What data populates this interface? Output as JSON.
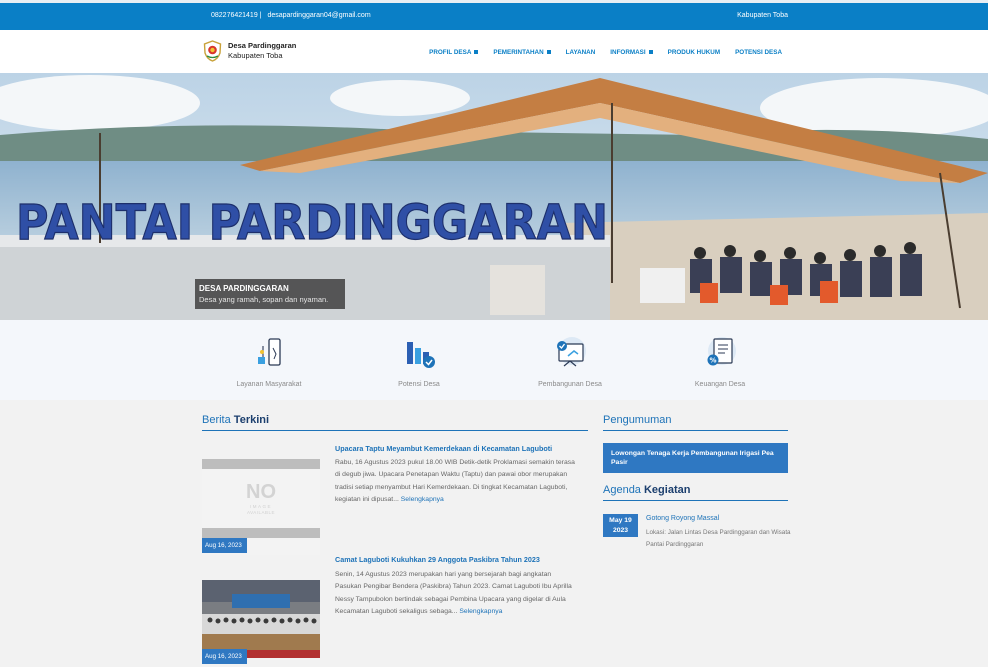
{
  "topbar": {
    "phone": "082276421419 |",
    "email": "desapardinggaran04@gmail.com",
    "region": "Kabupaten Toba"
  },
  "brand": {
    "name": "Desa Pardinggaran",
    "sub": "Kabupaten Toba",
    "logo_icon": "village-emblem-icon"
  },
  "nav": [
    {
      "label": "PROFIL DESA",
      "dropdown": true
    },
    {
      "label": "PEMERINTAHAN",
      "dropdown": true
    },
    {
      "label": "LAYANAN",
      "dropdown": false
    },
    {
      "label": "INFORMASI",
      "dropdown": true
    },
    {
      "label": "PRODUK HUKUM",
      "dropdown": false
    },
    {
      "label": "POTENSI DESA",
      "dropdown": false
    }
  ],
  "hero": {
    "sign_text": "PANTAI PARDINGGARAN",
    "caption_title": "DESA PARDINGGARAN",
    "caption_sub": "Desa yang ramah, sopan dan nyaman."
  },
  "services": [
    {
      "label": "Layanan Masyarakat",
      "icon": "phone-service-icon"
    },
    {
      "label": "Potensi Desa",
      "icon": "chart-check-icon"
    },
    {
      "label": "Pembangunan Desa",
      "icon": "board-check-icon"
    },
    {
      "label": "Keuangan Desa",
      "icon": "finance-document-icon"
    }
  ],
  "news": {
    "title_light": "Berita ",
    "title_bold": "Terkini",
    "items": [
      {
        "title": "Upacara Taptu Meyambut Kemerdekaan di Kecamatan Laguboti",
        "body": "Rabu, 16 Agustus 2023 pukul 18.00 WIB Detik-detik Proklamasi semakin terasa di degub jiwa. Upacara Penetapan Waktu (Taptu) dan pawai obor merupakan tradisi setiap menyambut Hari Kemerdekaan. Di tingkat Kecamatan Laguboti, kegiatan ini dipusat...",
        "more": "Selengkapnya",
        "date": "Aug 16, 2023",
        "placeholder_big": "NO",
        "placeholder_small1": "IMAGE",
        "placeholder_small2": "AVAILABLE"
      },
      {
        "title": "Camat Laguboti Kukuhkan 29 Anggota Paskibra Tahun 2023",
        "body": "Senin, 14 Agustus 2023 merupakan hari yang bersejarah bagi angkatan Pasukan Pengibar Bendera (Paskibra) Tahun 2023. Camat Laguboti Ibu Aprilla Nessy Tampubolon bertindak sebagai Pembina Upacara yang digelar di Aula Kecamatan Laguboti sekaligus sebaga...",
        "more": "Selengkapnya",
        "date": "Aug 16, 2023"
      }
    ]
  },
  "announcements": {
    "title": "Pengumuman",
    "items": [
      {
        "label": "Lowongan Tenaga Kerja Pembangunan Irigasi Pea Pasir"
      }
    ]
  },
  "agenda": {
    "title_light": "Agenda ",
    "title_bold": "Kegiatan",
    "items": [
      {
        "day": "May 19",
        "year": "2023",
        "title": "Gotong Royong Massal",
        "location": "Lokasi: Jalan Lintas Desa Pardinggaran dan Wisata Pantai Pardinggaran"
      }
    ]
  },
  "colors": {
    "primary": "#0a7fc6",
    "accent": "#2f78c2",
    "dark_title": "#1c3f6e"
  }
}
